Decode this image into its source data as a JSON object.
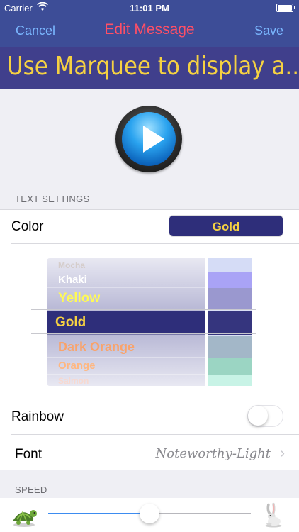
{
  "status_bar": {
    "carrier": "Carrier",
    "time": "11:01 PM"
  },
  "nav": {
    "cancel": "Cancel",
    "title": "Edit Message",
    "save": "Save"
  },
  "marquee_preview": {
    "text": "Use Marquee to display a..."
  },
  "text_settings": {
    "header": "TEXT SETTINGS",
    "color_label": "Color",
    "color_value": "Gold",
    "picker_options": [
      {
        "name": "Mocha",
        "color": "#c8b7a6"
      },
      {
        "name": "Khaki",
        "color": "#ffffff"
      },
      {
        "name": "Yellow",
        "color": "#fffa55"
      },
      {
        "name": "Gold",
        "color": "#f5d142"
      },
      {
        "name": "Dark Orange",
        "color": "#f9a36b"
      },
      {
        "name": "Orange",
        "color": "#ffb780"
      },
      {
        "name": "Salmon",
        "color": "#ffd4c4"
      }
    ],
    "selected_index": 3,
    "rainbow_label": "Rainbow",
    "rainbow_on": false,
    "font_label": "Font",
    "font_value": "Noteworthy-Light"
  },
  "speed": {
    "header": "SPEED",
    "level": 0.5
  },
  "colors": {
    "nav_bg": "#3d4d97",
    "accent": "#7ab7ff",
    "title": "#ff4f66",
    "gold": "#f5d142",
    "selected_row": "#2e2e7a"
  },
  "icons": [
    "wifi-icon",
    "battery-icon",
    "play-icon",
    "chevron-right-icon",
    "turtle-icon",
    "rabbit-icon"
  ]
}
